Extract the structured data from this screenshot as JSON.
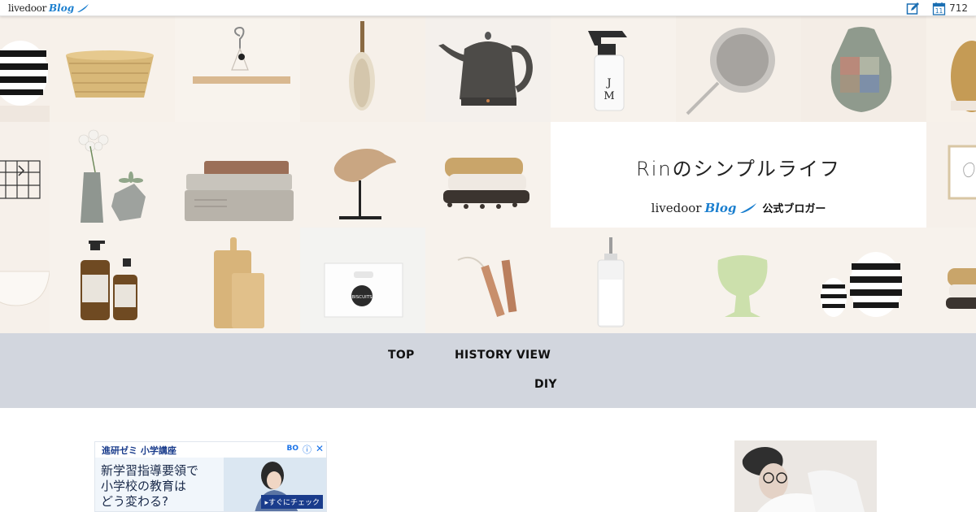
{
  "topbar": {
    "logo_text": "livedoor",
    "logo_blog": "Blog",
    "edit_icon": "pencil-square-icon",
    "calendar_icon": "calendar-icon",
    "calendar_day": "11",
    "count": "712"
  },
  "header": {
    "blog_title": "Rinのシンプルライフ",
    "official_logo_text": "livedoor",
    "official_logo_blog": "Blog",
    "official_label": "公式ブロガー",
    "tiles": [
      "striped-vase",
      "bamboo-basket",
      "wooden-hanger",
      "feather-duster",
      "kettle",
      "spray-bottle",
      "strainer",
      "drawstring-bag",
      "scrub-brush",
      "wire-basket",
      "flower-vase",
      "books",
      "wooden-bird",
      "scrub-brushes",
      "wall-frame",
      "bowl",
      "amber-bottles",
      "cutting-boards",
      "biscuits-box",
      "wooden-pieces",
      "glass-bottle",
      "green-bowl",
      "striped-vases",
      "brush-stack"
    ],
    "tile_labels": {
      "spray_bottle": "J\nM",
      "biscuits_box": "BISCUITS"
    }
  },
  "nav": {
    "items": [
      {
        "label": "TOP"
      },
      {
        "label": "HISTORY VIEW"
      },
      {
        "label": "DIY"
      }
    ]
  },
  "ad": {
    "brand": "進研ゼミ 小学講座",
    "mini_logo": "BO",
    "info_icon": "info-icon",
    "close_icon": "close-icon",
    "copy_line1": "新学習指導要領で",
    "copy_line2": "小学校の教育は",
    "copy_line3": "どう変わる?",
    "cta": "▸すぐにチェック"
  },
  "colors": {
    "nav_bg": "#d2d6de",
    "header_bg": "#f3ede7",
    "brand_blue": "#1b7fcf"
  }
}
